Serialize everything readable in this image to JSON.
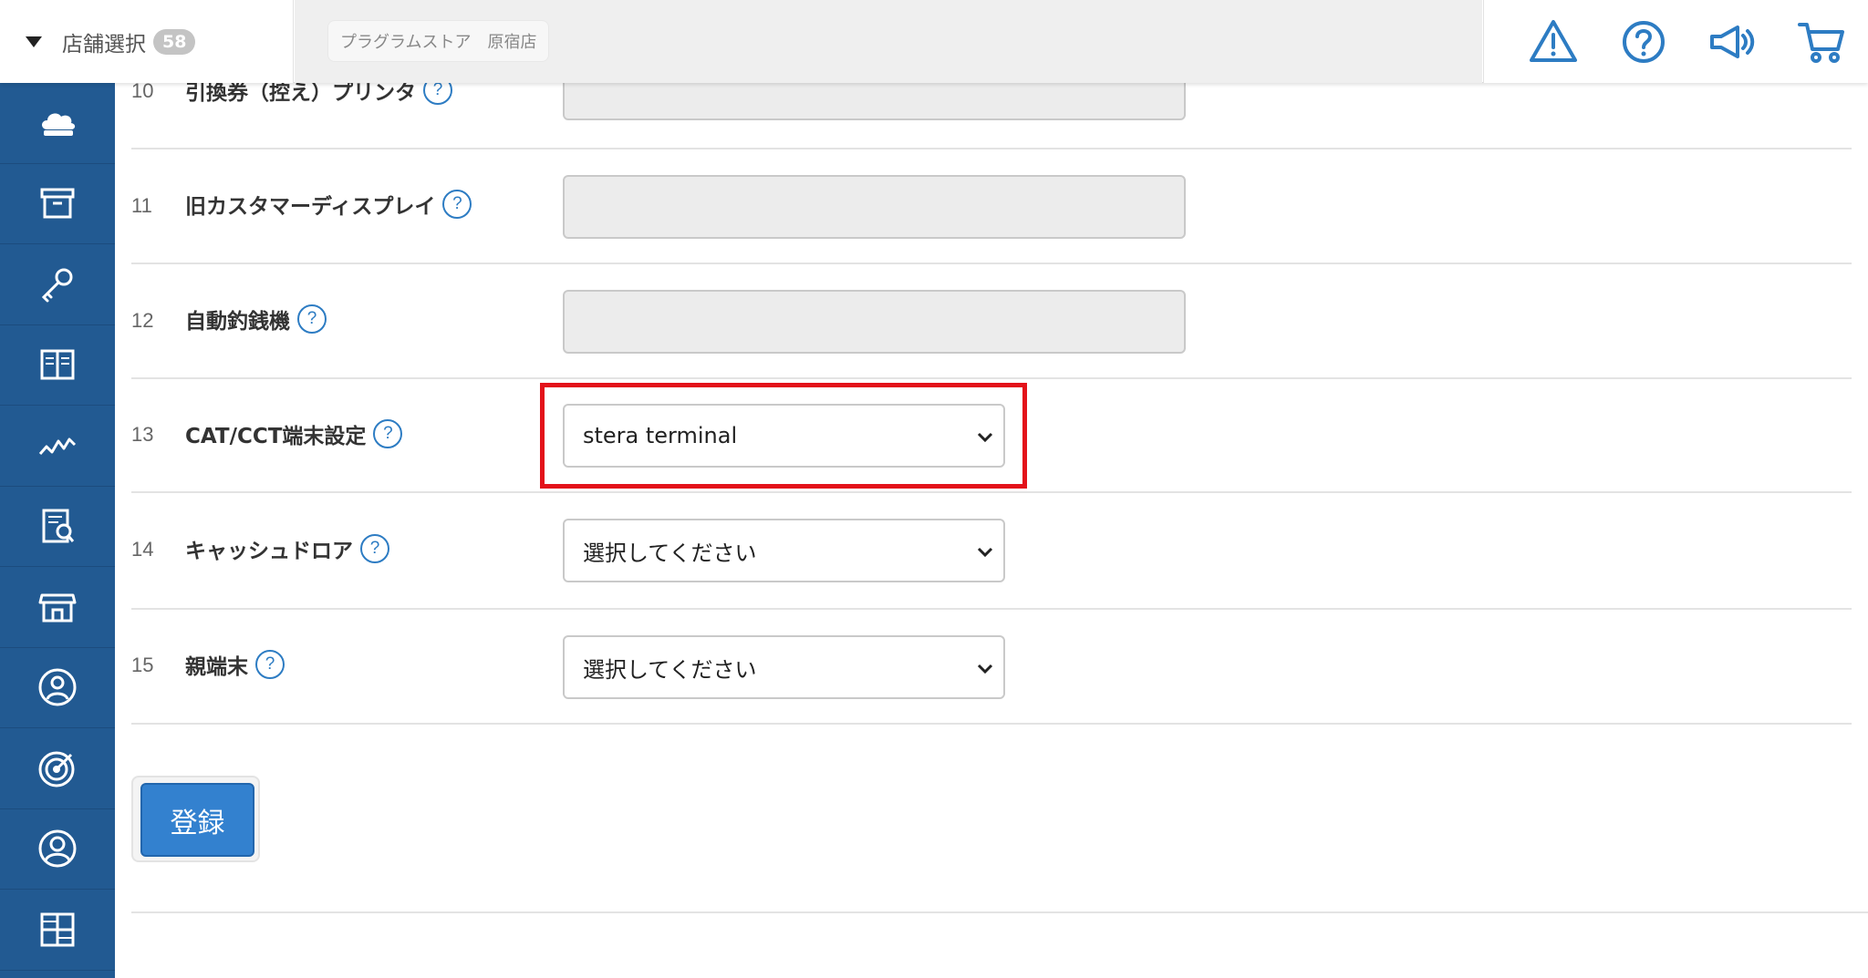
{
  "header": {
    "store_select_label": "店舗選択",
    "store_count": "58",
    "current_store": "プラグラムストア　原宿店",
    "icons": [
      "warning-icon",
      "help-icon",
      "announcement-icon",
      "cart-icon"
    ]
  },
  "sidebar": {
    "items": [
      {
        "icon": "cloud-icon"
      },
      {
        "icon": "archive-box-icon"
      },
      {
        "icon": "key-icon"
      },
      {
        "icon": "book-icon"
      },
      {
        "icon": "trend-chart-icon"
      },
      {
        "icon": "report-search-icon"
      },
      {
        "icon": "store-icon"
      },
      {
        "icon": "user-badge-icon"
      },
      {
        "icon": "target-icon"
      },
      {
        "icon": "user-icon"
      },
      {
        "icon": "grid-icon"
      }
    ]
  },
  "settings": {
    "rows": [
      {
        "num": "10",
        "label": "引換券（控え）プリンタ",
        "help": "?",
        "type": "disabled"
      },
      {
        "num": "11",
        "label": "旧カスタマーディスプレイ",
        "help": "?",
        "type": "disabled"
      },
      {
        "num": "12",
        "label": "自動釣銭機",
        "help": "?",
        "type": "disabled"
      },
      {
        "num": "13",
        "label": "CAT/CCT端末設定",
        "help": "?",
        "type": "select",
        "value": "stera terminal"
      },
      {
        "num": "14",
        "label": "キャッシュドロア",
        "help": "?",
        "type": "select",
        "value": "選択してください"
      },
      {
        "num": "15",
        "label": "親端末",
        "help": "?",
        "type": "select",
        "value": "選択してください"
      }
    ]
  },
  "submit_label": "登録",
  "colors": {
    "sidebar": "#225a92",
    "accent": "#2d7cc3",
    "button": "#3381cf",
    "highlight": "#e3121a"
  }
}
